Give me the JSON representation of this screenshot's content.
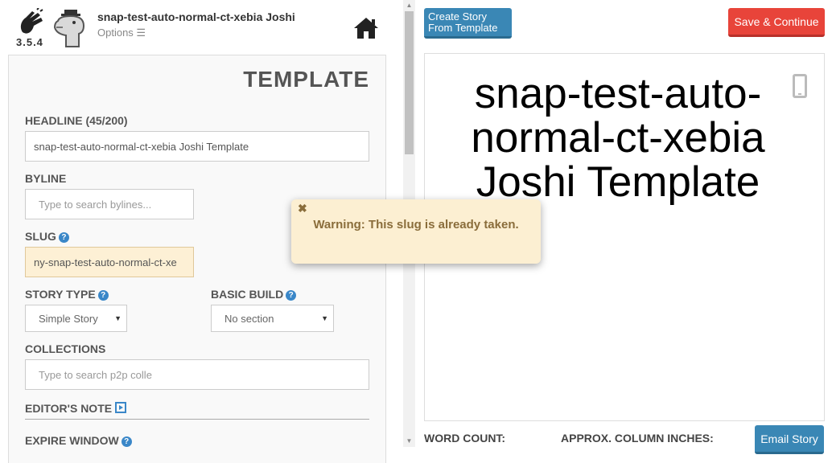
{
  "app": {
    "version": "3.5.4",
    "story_title": "snap-test-auto-normal-ct-xebia Joshi",
    "options_label": "Options ☰"
  },
  "form": {
    "panel_title": "TEMPLATE",
    "headline": {
      "label": "HEADLINE (45/200)",
      "value": "snap-test-auto-normal-ct-xebia Joshi Template"
    },
    "byline": {
      "label": "BYLINE",
      "placeholder": "Type to search bylines..."
    },
    "slug": {
      "label": "SLUG",
      "value": "ny-snap-test-auto-normal-ct-xe"
    },
    "story_type": {
      "label": "STORY TYPE",
      "selected": "Simple Story"
    },
    "basic_build": {
      "label": "BASIC BUILD",
      "selected": "No section"
    },
    "collections": {
      "label": "COLLECTIONS",
      "placeholder": "Type to search p2p colle"
    },
    "editors_note": {
      "label": "EDITOR'S NOTE"
    },
    "expire_window": {
      "label": "EXPIRE WINDOW"
    }
  },
  "toolbar": {
    "create_template_label": "Create Story From Template",
    "save_label": "Save & Continue",
    "email_label": "Email Story"
  },
  "preview": {
    "headline": "snap-test-auto-normal-ct-xebia Joshi Template"
  },
  "stats": {
    "word_count_label": "WORD COUNT:",
    "column_inches_label": "APPROX. COLUMN INCHES:"
  },
  "toast": {
    "close_glyph": "✖",
    "message": "Warning: This slug is already taken."
  },
  "colors": {
    "primary": "#3a87b5",
    "danger": "#e8443a",
    "warning_bg": "#fcefd2",
    "warning_text": "#8a6d3b",
    "slug_bg": "#fdf0d5"
  }
}
